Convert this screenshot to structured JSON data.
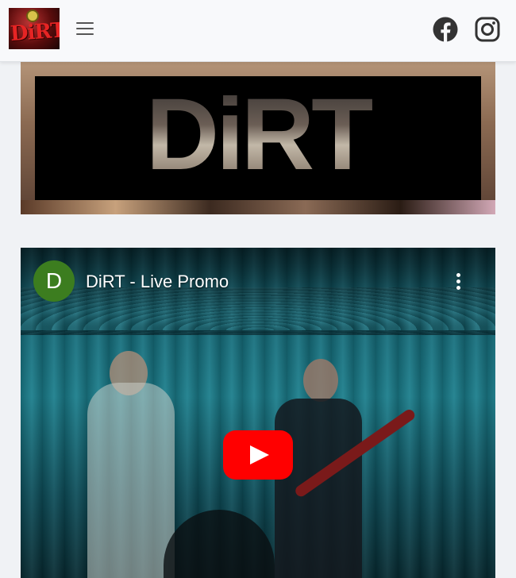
{
  "nav": {
    "logo_text": "DiRT",
    "menu_icon": "hamburger-menu-icon",
    "social": [
      {
        "name": "facebook-icon",
        "color": "#333333"
      },
      {
        "name": "instagram-icon",
        "color": "#333333"
      }
    ]
  },
  "hero": {
    "wordmark": "DiRT"
  },
  "video": {
    "channel_initial": "D",
    "channel_color": "#3c7d1f",
    "title": "DiRT - Live Promo",
    "menu_icon": "more-vertical-icon",
    "play_icon": "youtube-play-icon",
    "play_color": "#ff0000"
  }
}
